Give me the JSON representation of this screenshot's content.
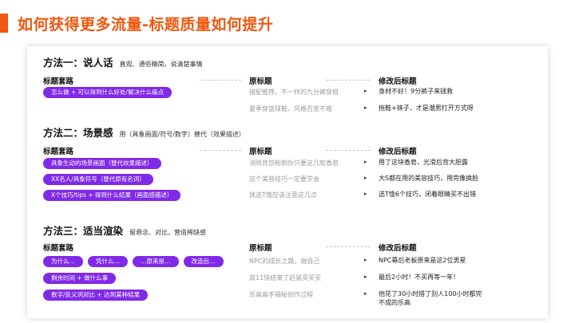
{
  "slide": {
    "title": "如何获得更多流量-标题质量如何提升"
  },
  "columns": {
    "pattern": "标题套路",
    "original": "原标题",
    "modified": "修改后标题"
  },
  "sections": [
    {
      "title": "方法一：说人话",
      "desc": "直观、通俗精简，说清楚事情",
      "rows": [
        {
          "pills": [
            "怎么做 + 可以得到什么好处/解决什么痛点"
          ],
          "original": "搭配推荐，不一样的九分裤穿搭",
          "modified": "身材不好！9分裤子来拯救"
        },
        {
          "pills": [],
          "original": "夏季穿篮球鞋，风格百变不难",
          "modified": "拖鞋+袜子，才是潮男打开方式呀"
        }
      ]
    },
    {
      "title": "方法二：场景感",
      "desc": "用（具象画面/符号/数字）替代（效果描述）",
      "rows": [
        {
          "pills": [
            "具象生动的场景画面（替代效果描述）"
          ],
          "original": "消除背部粉刺你只要这几款香皂",
          "modified": "用了这块香皂，光滑后背大胆露"
        },
        {
          "pills": [
            "XX名人/具象符号（替代原有名词）"
          ],
          "original": "这个美容技巧一定要学会",
          "modified": "大S都在用的美容技巧，用完像换脸"
        },
        {
          "pills": [
            "X个技巧/tips + 得到什么结果（画面感描述）"
          ],
          "original": "挑选T恤应该注意这几点",
          "modified": "选T恤6个技巧，闭着眼睛买不出错"
        }
      ]
    },
    {
      "title": "方法三：适当渲染",
      "desc": "留悬念、对比，营造稀缺感",
      "rows": [
        {
          "pills": [
            "为什么…",
            "凭什么…",
            "…原来是…",
            "改造后…"
          ],
          "original": "NPC的成长之路，做自己",
          "modified": "NPC幕后老板原来是这2位男星"
        },
        {
          "pills": [
            "剩余时间 + 做什么事"
          ],
          "original": "双11快结束了赶紧买买买",
          "modified": "最后2小时！不买再等一年！"
        },
        {
          "pills": [
            "数字/反义词对比 + 达到某种结果"
          ],
          "original": "乐高高手揭秘创作过程",
          "modified": "他花了30小时搭了别人100小时都完不成的乐高"
        }
      ]
    }
  ],
  "icons": {
    "arrow": "▸"
  },
  "colors": {
    "accent": "#f0570f",
    "pill": "#8129e8"
  }
}
